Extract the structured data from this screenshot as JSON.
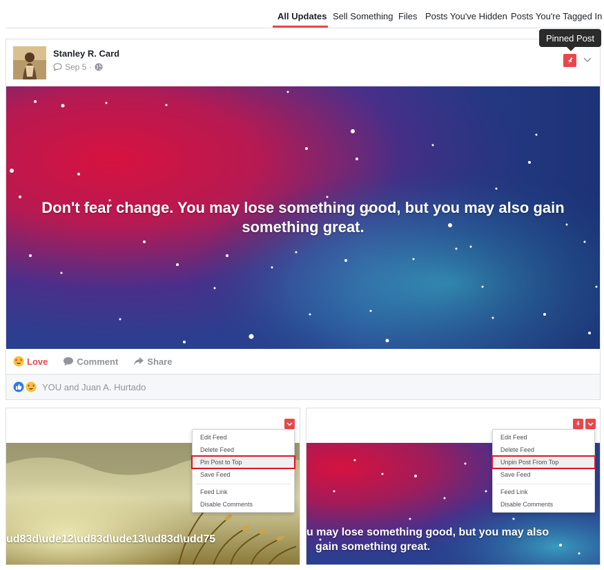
{
  "tabs": [
    {
      "label": "All Updates",
      "active": true
    },
    {
      "label": "Sell Something",
      "active": false
    },
    {
      "label": "Files",
      "active": false
    },
    {
      "label": "Posts You've Hidden",
      "active": false
    },
    {
      "label": "Posts You're Tagged In",
      "active": false
    }
  ],
  "post": {
    "author": "Stanley R. Card",
    "date": "Sep 5",
    "privacy_icon": "globe-icon",
    "pinned_tooltip": "Pinned Post",
    "quote": "Don't fear change. You may lose something good, but you may also gain something great.",
    "actions": {
      "love": "Love",
      "comment": "Comment",
      "share": "Share"
    },
    "reactions_text": "YOU and Juan A. Hurtado"
  },
  "cards": [
    {
      "caption": "ud83d\\ude12\\ud83d\\ude13\\ud83d\\udd75",
      "menu": [
        "Edit Feed",
        "Delete Feed",
        "Pin Post to Top",
        "Save Feed",
        "Feed Link",
        "Disable Comments"
      ],
      "highlighted": "Pin Post to Top"
    },
    {
      "caption_line1": "u may lose something good, but you may also",
      "caption_line2": "gain something great.",
      "menu": [
        "Edit Feed",
        "Delete Feed",
        "Unpin Post From Top",
        "Save Feed",
        "Feed Link",
        "Disable Comments"
      ],
      "highlighted": "Unpin Post From Top"
    }
  ],
  "colors": {
    "accent": "#e8484b",
    "highlight_border": "#d9162b",
    "muted_text": "#90949c"
  }
}
